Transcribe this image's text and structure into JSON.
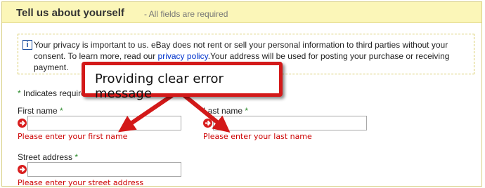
{
  "header": {
    "title": "Tell us about yourself",
    "subtitle": "- All fields are required"
  },
  "notice": {
    "icon": "info-icon",
    "text_before": "Your privacy is important to us. eBay does not rent or sell your personal information to third parties without your consent. To learn more, read our ",
    "link": "privacy policy",
    "text_after": ".Your address will be used for posting your purchase or receiving payment."
  },
  "required_note": {
    "star": "*",
    "text": "Indicates required"
  },
  "fields": {
    "first_name": {
      "label": "First name",
      "star": "*",
      "value": "",
      "error": "Please enter your first name"
    },
    "last_name": {
      "label": "Last name",
      "star": "*",
      "value": "",
      "error": "Please enter your last name"
    },
    "street_address": {
      "label": "Street address",
      "star": "*",
      "value": "",
      "error": "Please enter your street address"
    }
  },
  "callout": {
    "text": "Providing clear error message",
    "color": "#d31919"
  },
  "colors": {
    "header_bg": "#fbf6b8",
    "error_text": "#cc0000",
    "required_star": "#2a8a2a",
    "link": "#0033cc"
  }
}
